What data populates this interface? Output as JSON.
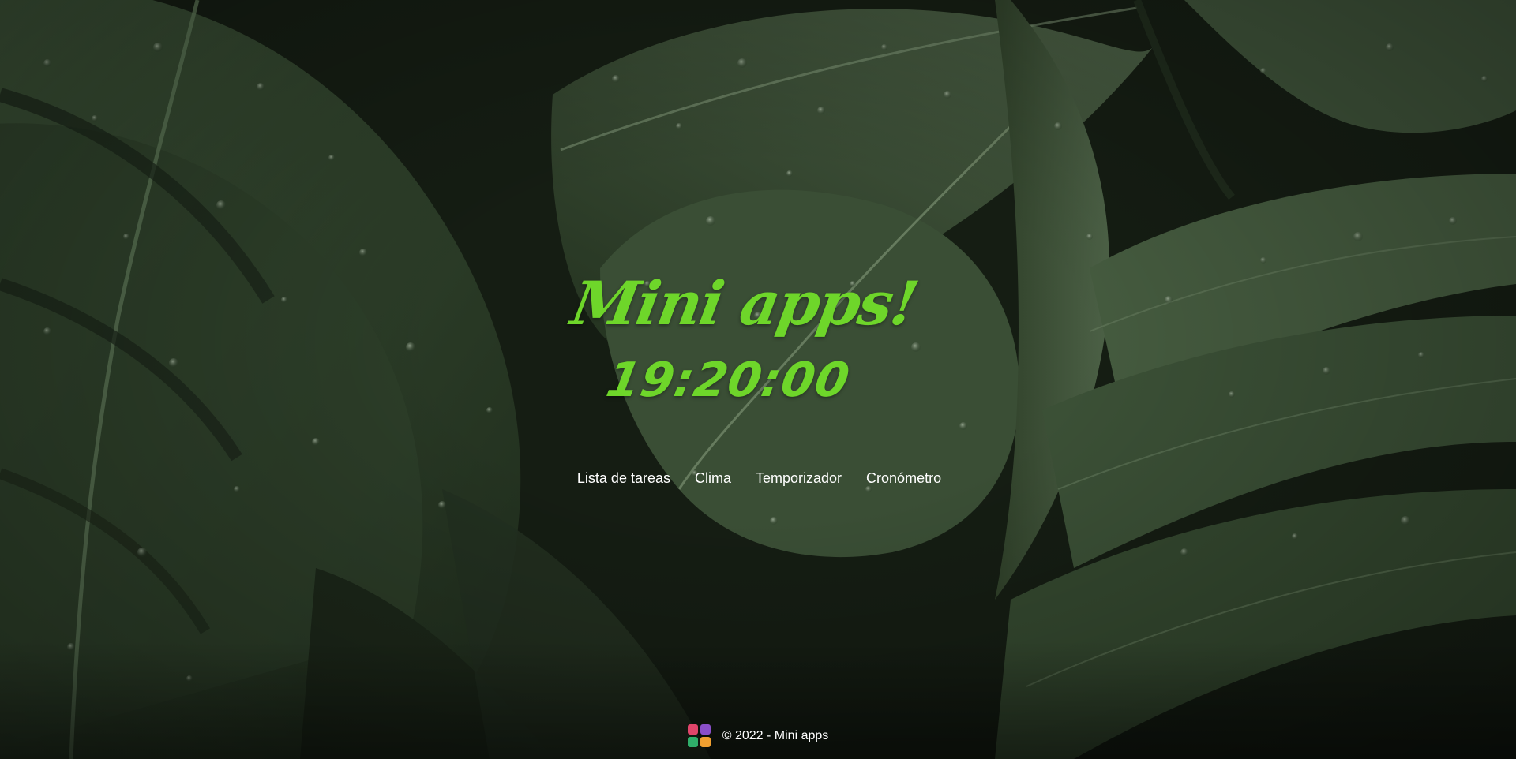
{
  "header": {
    "title": "Mini apps!",
    "clock": "19:20:00"
  },
  "nav": {
    "items": [
      {
        "label": "Lista de tareas"
      },
      {
        "label": "Clima"
      },
      {
        "label": "Temporizador"
      },
      {
        "label": "Cronómetro"
      }
    ]
  },
  "footer": {
    "text": "© 2022 - Mini apps",
    "logo_icon": "app-grid-icon",
    "logo_colors": [
      "#e0456a",
      "#8a4fc9",
      "#2fae6a",
      "#f0a030"
    ]
  },
  "colors": {
    "accent": "#6ed62a",
    "nav_text": "#ffffff",
    "background": "#1b2418"
  }
}
